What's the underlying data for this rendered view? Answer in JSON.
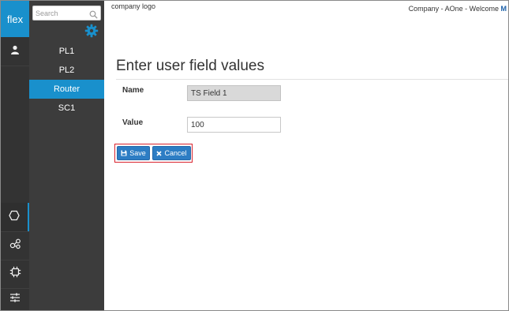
{
  "rail": {
    "brand": "flex",
    "icons": [
      "user-icon",
      "hexagon-icon",
      "share-nodes-icon",
      "chip-icon",
      "sliders-icon"
    ]
  },
  "nav": {
    "search_placeholder": "Search",
    "items": [
      {
        "label": "PL1",
        "active": false
      },
      {
        "label": "PL2",
        "active": false
      },
      {
        "label": "Router",
        "active": true
      },
      {
        "label": "SC1",
        "active": false
      }
    ]
  },
  "header": {
    "logo_text": "company logo",
    "company_text": "Company - AOne - Welcome ",
    "user_initial": "M"
  },
  "form": {
    "title": "Enter user field values",
    "name_label": "Name",
    "name_value": "TS Field 1",
    "value_label": "Value",
    "value_value": "100",
    "save_label": "Save",
    "cancel_label": "Cancel"
  },
  "colors": {
    "accent": "#1990cc",
    "rail_bg": "#333333",
    "nav_bg": "#3c3c3c",
    "button": "#2d7dc4",
    "highlight_border": "#d9232e"
  }
}
